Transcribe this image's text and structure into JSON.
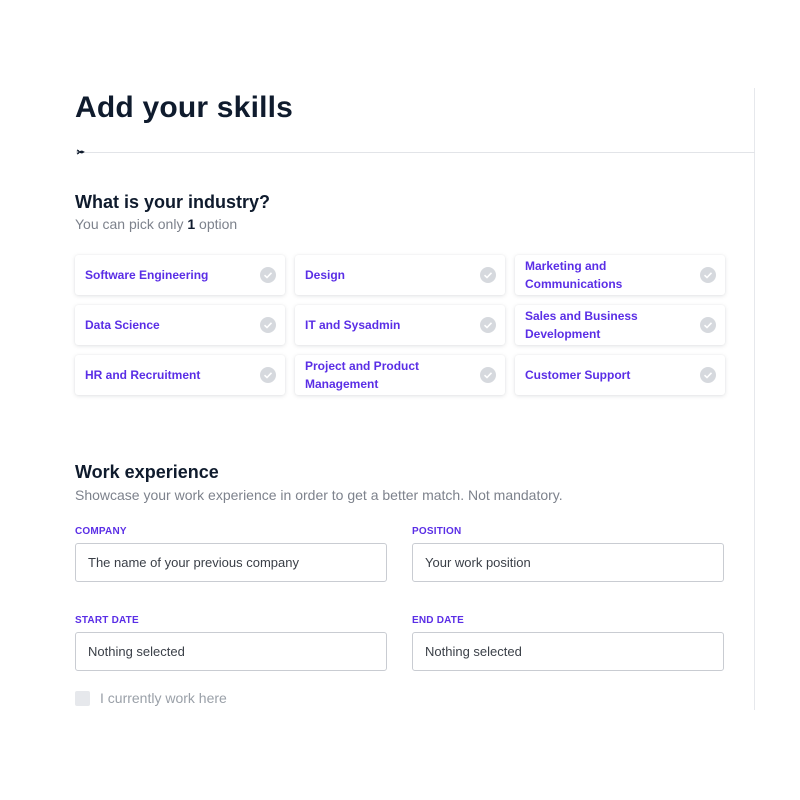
{
  "page": {
    "title": "Add your skills"
  },
  "progress": {
    "icon": "rocket-icon"
  },
  "industry": {
    "title": "What is your industry?",
    "subtitle_prefix": "You can pick only ",
    "subtitle_count": "1",
    "subtitle_suffix": " option",
    "options": [
      {
        "label": "Software Engineering"
      },
      {
        "label": "Design"
      },
      {
        "label": "Marketing and Communications"
      },
      {
        "label": "Data Science"
      },
      {
        "label": "IT and Sysadmin"
      },
      {
        "label": "Sales and Business Development"
      },
      {
        "label": "HR and Recruitment"
      },
      {
        "label": "Project and Product Management"
      },
      {
        "label": "Customer Support"
      }
    ]
  },
  "work": {
    "title": "Work experience",
    "subtitle": "Showcase your work experience in order to get a better match. Not mandatory.",
    "company": {
      "label": "COMPANY",
      "placeholder": "The name of your previous company"
    },
    "position": {
      "label": "POSITION",
      "placeholder": "Your work position"
    },
    "start_date": {
      "label": "START DATE",
      "value": "Nothing selected"
    },
    "end_date": {
      "label": "END DATE",
      "value": "Nothing selected"
    },
    "current": {
      "label": "I currently work here"
    }
  },
  "colors": {
    "accent": "#5a2ee6",
    "heading": "#0f1b2d",
    "muted": "#7d828c",
    "check": "#d6d9de"
  }
}
